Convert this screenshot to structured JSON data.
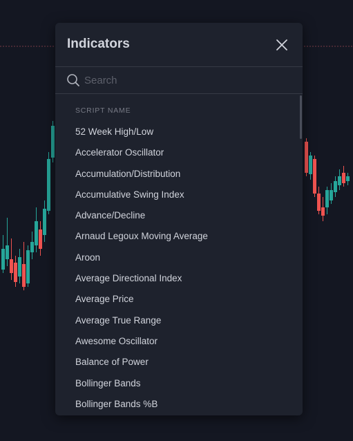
{
  "modal": {
    "title": "Indicators",
    "close_icon": "close-icon"
  },
  "search": {
    "placeholder": "Search",
    "value": "",
    "icon": "search-icon"
  },
  "list": {
    "column_header": "SCRIPT NAME",
    "items": [
      "52 Week High/Low",
      "Accelerator Oscillator",
      "Accumulation/Distribution",
      "Accumulative Swing Index",
      "Advance/Decline",
      "Arnaud Legoux Moving Average",
      "Aroon",
      "Average Directional Index",
      "Average Price",
      "Average True Range",
      "Awesome Oscillator",
      "Balance of Power",
      "Bollinger Bands",
      "Bollinger Bands %B"
    ]
  },
  "colors": {
    "background": "#141722",
    "panel": "#1e222d",
    "text": "#d1d4dc",
    "muted": "#787b86",
    "bull": "#26a69a",
    "bear": "#ef5350"
  }
}
